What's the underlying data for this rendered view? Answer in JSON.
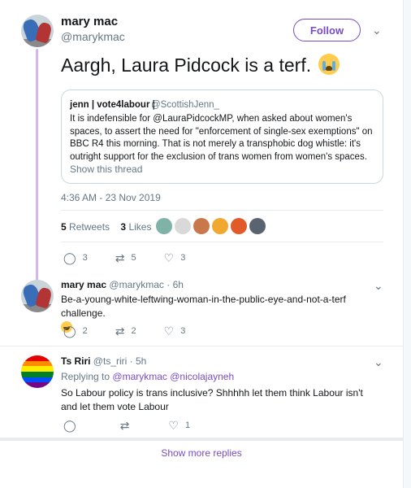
{
  "main_tweet": {
    "author_name": "mary mac",
    "author_handle": "@marykmac",
    "follow_label": "Follow",
    "text": "Aargh, Laura Pidcock is a terf.",
    "emoji": "crying-face",
    "quoted": {
      "author_name": "jenn | vote4labour |",
      "author_handle": "@ScottishJenn_",
      "text": "It is indefensible for @LauraPidcockMP, when asked about women's spaces, to assert the need for \"enforcement of single-sex exemptions\" on BBC R4 this morning. That is not merely a transphobic dog whistle: it's outright support for the exclusion of trans women from women's spaces.",
      "show_thread": "Show this thread"
    },
    "timestamp": "4:36 AM - 23 Nov 2019",
    "retweets_count": "5",
    "retweets_label": "Retweets",
    "likes_count": "3",
    "likes_label": "Likes",
    "liker_colors": [
      "#7fb3a8",
      "#d9d9d9",
      "#c8784a",
      "#f0a830",
      "#e05a2a",
      "#5a6470"
    ],
    "actions": {
      "reply_count": "3",
      "retweet_count": "5",
      "like_count": "3"
    }
  },
  "replies": [
    {
      "author_name": "mary mac",
      "author_handle": "@marykmac",
      "time": "6h",
      "text": "Be-a-young-white-leftwing-woman-in-the-public-eye-and-not-a-terf challenge.",
      "emoji": "grinning-sweat-face",
      "reply_count": "2",
      "retweet_count": "2",
      "like_count": "3"
    },
    {
      "author_name": "Ts Riri",
      "author_handle": "@ts_riri",
      "time": "5h",
      "replying_to_label": "Replying to",
      "replying_to": "@marykmac @nicolajayneh",
      "text": "So Labour policy is trans inclusive? Shhhhh let them think Labour isn't and let them vote Labour",
      "reply_count": "",
      "retweet_count": "",
      "like_count": "1",
      "avatar_stripes": [
        "#e40303",
        "#ff8c00",
        "#ffed00",
        "#008026",
        "#004dff",
        "#750787"
      ]
    }
  ],
  "separator": "·",
  "show_more_replies": "Show more replies",
  "icons": {
    "reply": "reply-icon",
    "retweet": "retweet-icon",
    "like": "heart-icon",
    "chevron": "chevron-down-icon"
  }
}
